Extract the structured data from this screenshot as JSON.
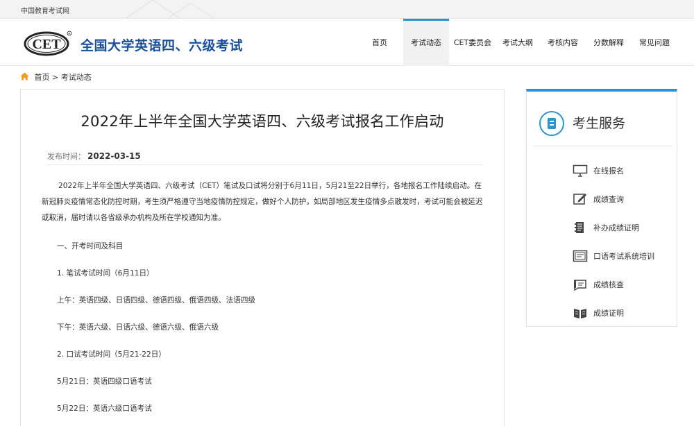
{
  "topbar": {
    "site_link": "中国教育考试网"
  },
  "header": {
    "logo_text": "CET",
    "title": "全国大学英语四、六级考试",
    "nav": [
      {
        "label": "首页",
        "active": false
      },
      {
        "label": "考试动态",
        "active": true
      },
      {
        "label": "CET委员会",
        "active": false
      },
      {
        "label": "考试大纲",
        "active": false
      },
      {
        "label": "考核内容",
        "active": false
      },
      {
        "label": "分数解释",
        "active": false
      },
      {
        "label": "常见问题",
        "active": false
      }
    ]
  },
  "breadcrumb": {
    "home": "首页",
    "separator": ">",
    "current": "考试动态"
  },
  "article": {
    "title": "2022年上半年全国大学英语四、六级考试报名工作启动",
    "date_label": "发布时间：",
    "date": "2022-03-15",
    "paragraph": "2022年上半年全国大学英语四、六级考试（CET）笔试及口试将分别于6月11日，5月21至22日举行，各地报名工作陆续启动。在新冠肺炎疫情常态化防控时期，考生须严格遵守当地疫情防控规定，做好个人防护。如局部地区发生疫情多点散发时，考试可能会被延迟或取消，届时请以各省级承办机构及所在学校通知为准。",
    "lines": [
      "一、开考时间及科目",
      "1. 笔试考试时间（6月11日）",
      "上午：英语四级、日语四级、德语四级、俄语四级、法语四级",
      "下午：英语六级、日语六级、德语六级、俄语六级",
      "2. 口试考试时间（5月21-22日）",
      "5月21日：英语四级口语考试",
      "5月22日：英语六级口语考试"
    ]
  },
  "service": {
    "title": "考生服务",
    "items": [
      {
        "label": "在线报名",
        "icon": "monitor-icon"
      },
      {
        "label": "成绩查询",
        "icon": "edit-icon"
      },
      {
        "label": "补办成绩证明",
        "icon": "document-icon"
      },
      {
        "label": "口语考试系统培训",
        "icon": "screen-icon"
      },
      {
        "label": "成绩核查",
        "icon": "check-icon"
      },
      {
        "label": "成绩证明",
        "icon": "book-icon"
      }
    ]
  },
  "colors": {
    "accent": "#2a93d2",
    "title_blue": "#1a4f99"
  }
}
